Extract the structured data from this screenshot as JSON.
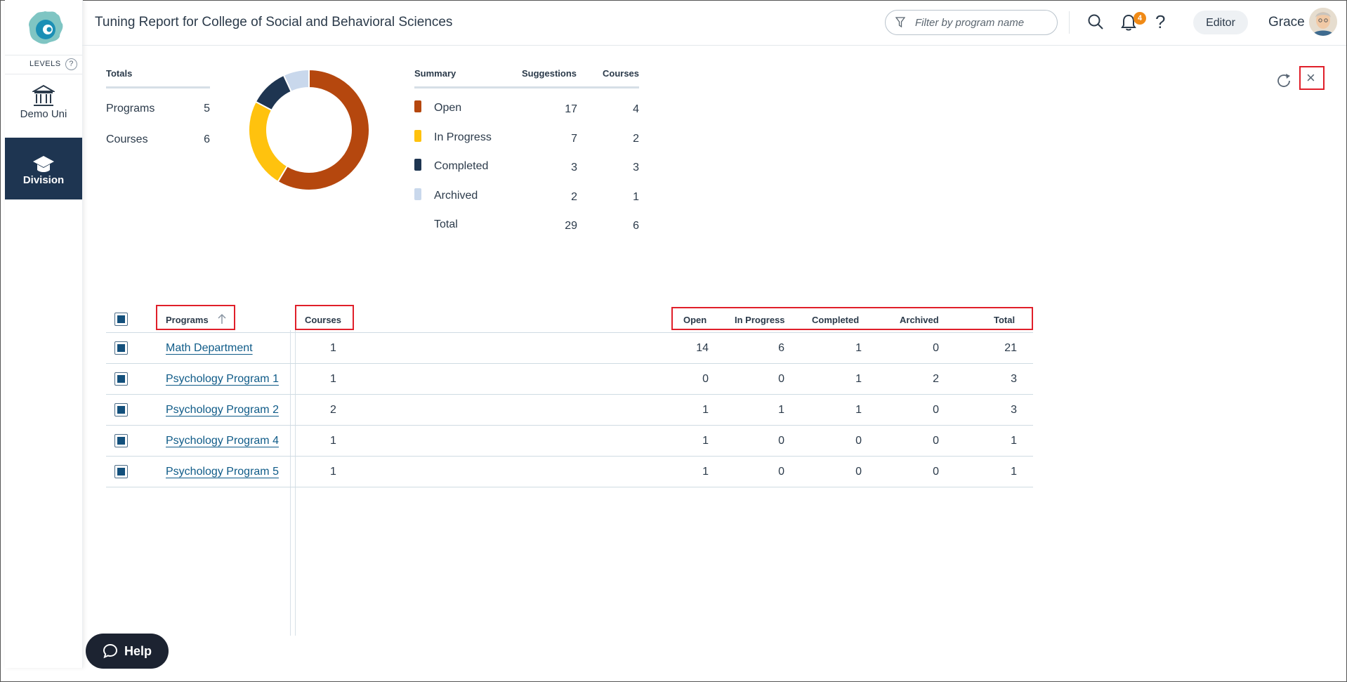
{
  "header": {
    "title": "Tuning Report for College of Social and Behavioral Sciences",
    "filter_placeholder": "Filter by program name",
    "notification_count": "4",
    "editor_label": "Editor",
    "user_name": "Grace"
  },
  "sidebar": {
    "levels_label": "LEVELS",
    "levels_help": "?",
    "items": [
      {
        "label": "Demo Uni",
        "icon": "institution-icon"
      },
      {
        "label": "Division",
        "icon": "graduation-cap-icon",
        "active": true
      }
    ]
  },
  "totals": {
    "heading": "Totals",
    "rows": [
      {
        "label": "Programs",
        "value": "5"
      },
      {
        "label": "Courses",
        "value": "6"
      }
    ]
  },
  "summary": {
    "heading": "Summary",
    "col_suggestions": "Suggestions",
    "col_courses": "Courses",
    "rows": [
      {
        "label": "Open",
        "suggestions": "17",
        "courses": "4",
        "color": "#b5470e"
      },
      {
        "label": "In Progress",
        "suggestions": "7",
        "courses": "2",
        "color": "#ffc20e"
      },
      {
        "label": "Completed",
        "suggestions": "3",
        "courses": "3",
        "color": "#1e3551"
      },
      {
        "label": "Archived",
        "suggestions": "2",
        "courses": "1",
        "color": "#c9d8ec"
      }
    ],
    "total": {
      "label": "Total",
      "suggestions": "29",
      "courses": "6"
    }
  },
  "donut": {
    "segments": [
      {
        "label": "Open",
        "value": 17,
        "color": "#b5470e"
      },
      {
        "label": "In Progress",
        "value": 7,
        "color": "#ffc20e"
      },
      {
        "label": "Completed",
        "value": 3,
        "color": "#1e3551"
      },
      {
        "label": "Archived",
        "value": 2,
        "color": "#c9d8ec"
      }
    ]
  },
  "table": {
    "headers": {
      "programs": "Programs",
      "courses": "Courses",
      "open": "Open",
      "in_progress": "In Progress",
      "completed": "Completed",
      "archived": "Archived",
      "total": "Total"
    },
    "rows": [
      {
        "program": "Math Department",
        "courses": "1",
        "open": "14",
        "in_progress": "6",
        "completed": "1",
        "archived": "0",
        "total": "21"
      },
      {
        "program": "Psychology Program 1",
        "courses": "1",
        "open": "0",
        "in_progress": "0",
        "completed": "1",
        "archived": "2",
        "total": "3"
      },
      {
        "program": "Psychology Program 2",
        "courses": "2",
        "open": "1",
        "in_progress": "1",
        "completed": "1",
        "archived": "0",
        "total": "3"
      },
      {
        "program": "Psychology Program 4",
        "courses": "1",
        "open": "1",
        "in_progress": "0",
        "completed": "0",
        "archived": "0",
        "total": "1"
      },
      {
        "program": "Psychology Program 5",
        "courses": "1",
        "open": "1",
        "in_progress": "0",
        "completed": "0",
        "archived": "0",
        "total": "1"
      }
    ]
  },
  "help_label": "Help"
}
